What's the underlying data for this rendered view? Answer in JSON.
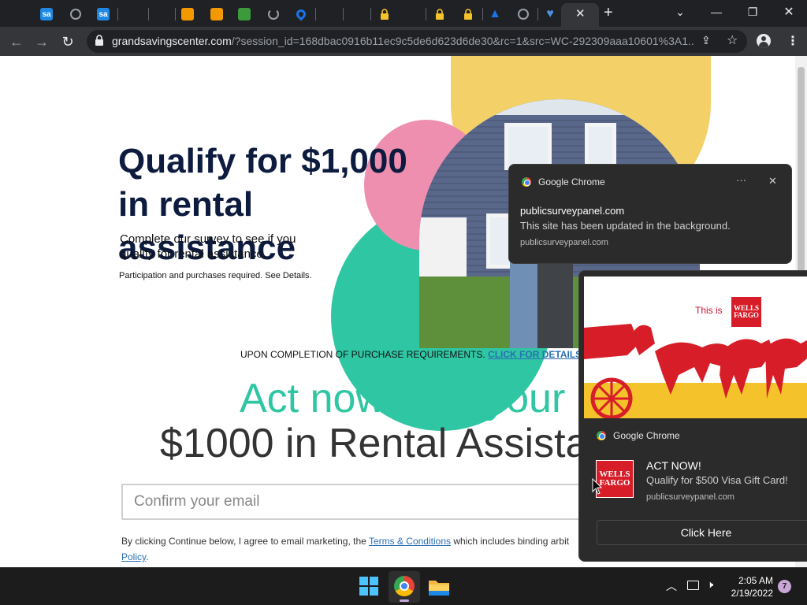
{
  "browser": {
    "tabs": [
      {
        "icon": "sa-icon",
        "color": "#1e88e5",
        "glyph": "sa"
      },
      {
        "icon": "globe-icon",
        "color": "#9aa0a6",
        "glyph": ""
      },
      {
        "icon": "sa-icon",
        "color": "#1e88e5",
        "glyph": "sa"
      },
      {
        "icon": "blank-icon",
        "color": "",
        "glyph": ""
      },
      {
        "icon": "blank-icon",
        "color": "",
        "glyph": ""
      },
      {
        "icon": "check-icon",
        "color": "#f29900",
        "glyph": ""
      },
      {
        "icon": "book-icon",
        "color": "#f29900",
        "glyph": ""
      },
      {
        "icon": "money-icon",
        "color": "#3c9a3c",
        "glyph": ""
      },
      {
        "icon": "loading-icon",
        "color": "#9aa0a6",
        "glyph": ""
      },
      {
        "icon": "location-icon",
        "color": "#1a73e8",
        "glyph": ""
      },
      {
        "icon": "blank-icon",
        "color": "",
        "glyph": ""
      },
      {
        "icon": "blank-icon",
        "color": "",
        "glyph": ""
      },
      {
        "icon": "lock-icon",
        "color": "#f4c22b",
        "glyph": ""
      },
      {
        "icon": "blank-icon",
        "color": "",
        "glyph": ""
      },
      {
        "icon": "lock-icon",
        "color": "#f4c22b",
        "glyph": ""
      },
      {
        "icon": "lock-icon",
        "color": "#f4c22b",
        "glyph": ""
      },
      {
        "icon": "arrow-icon",
        "color": "#1a73e8",
        "glyph": ""
      },
      {
        "icon": "globe-icon",
        "color": "#9aa0a6",
        "glyph": ""
      },
      {
        "icon": "heart-icon",
        "color": "#4a90e2",
        "glyph": ""
      }
    ],
    "url_host": "grandsavingscenter.com",
    "url_rest": "/?session_id=168dbac0916b11ec9c5de6d623d6de30&rc=1&src=WC-292309aaa10601%3A1..."
  },
  "page": {
    "hero_title": "Qualify for $1,000 in rental assistance",
    "hero_sub": "Complete our survey to see if you qualify for rental assistance.",
    "hero_fine": "Participation and purchases required. See Details.",
    "completion_text": "UPON COMPLETION OF PURCHASE REQUIREMENTS.",
    "completion_link": "CLICK FOR DETAILS",
    "act_line1": "Act now! Get your",
    "act_line2": "$1000 in Rental Assistar",
    "email_placeholder": "Confirm your email",
    "legal_prefix": "By clicking Continue below, I agree to email marketing, the",
    "legal_link1": "Terms & Conditions",
    "legal_middle": "which includes binding arbit",
    "legal_link2": "Policy",
    "legal_end": "."
  },
  "notification1": {
    "app": "Google Chrome",
    "more": "···",
    "close": "✕",
    "title": "publicsurveypanel.com",
    "body": "This site has been updated in the background.",
    "source": "publicsurveypanel.com"
  },
  "notification2": {
    "banner_text": "This is",
    "logo_line1": "WELLS",
    "logo_line2": "FARGO",
    "app": "Google Chrome",
    "title": "ACT NOW!",
    "body": "Qualify for $500 Visa Gift Card!",
    "source": "publicsurveypanel.com",
    "button": "Click Here"
  },
  "taskbar": {
    "time": "2:05 AM",
    "date": "2/19/2022",
    "notifications_badge": "7"
  }
}
